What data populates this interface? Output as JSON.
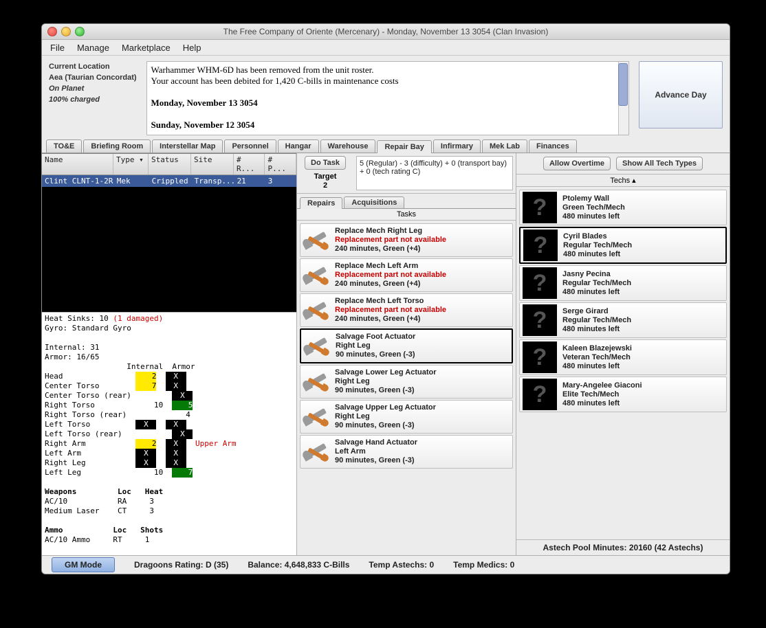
{
  "window_title": "The Free Company of Oriente (Mercenary) - Monday, November 13 3054 (Clan Invasion)",
  "menu": [
    "File",
    "Manage",
    "Marketplace",
    "Help"
  ],
  "location": {
    "header": "Current Location",
    "place": "Aea (Taurian Concordat)",
    "status": "On Planet",
    "charge": "100% charged"
  },
  "log": {
    "line1": "Warhammer WHM-6D has been removed from the unit roster.",
    "line2": "Your account has been debited for 1,420 C-bills in maintenance costs",
    "date1": "Monday, November 13 3054",
    "date2": "Sunday, November 12 3054"
  },
  "advance_label": "Advance Day",
  "tabs": [
    "TO&E",
    "Briefing Room",
    "Interstellar Map",
    "Personnel",
    "Hangar",
    "Warehouse",
    "Repair Bay",
    "Infirmary",
    "Mek Lab",
    "Finances"
  ],
  "active_tab_index": 6,
  "unit_table": {
    "headers": [
      "Name",
      "Type ▾",
      "Status",
      "Site",
      "# R...",
      "# P..."
    ],
    "row": {
      "name": "Clint CLNT-1-2R",
      "type": "Mek",
      "status": "Crippled",
      "site": "Transp...",
      "r": "21",
      "p": "3"
    }
  },
  "detail_text": {
    "l1": "Heat Sinks: 10 ",
    "l1d": "(1 damaged)",
    "l2": "Gyro: Standard Gyro",
    "l3": "",
    "l4": "Internal: 31",
    "l5": "Armor: 16/65",
    "hdr": "                  Internal  Armor",
    "arm_note": "Upper Arm",
    "weap_h": "Weapons         Loc   Heat",
    "w1": "AC/10           RA     3",
    "w2": "Medium Laser    CT     3",
    "ammo_h": "Ammo           Loc   Shots",
    "a1": "AC/10 Ammo     RT     1"
  },
  "locations": [
    {
      "name": "Head",
      "int_type": "y",
      "int_v": "2",
      "arm_type": "k",
      "arm_v": "X"
    },
    {
      "name": "Center Torso",
      "int_type": "y",
      "int_v": "7",
      "arm_type": "k",
      "arm_v": "X"
    },
    {
      "name": "Center Torso (rear)",
      "int_type": "",
      "int_v": "",
      "arm_type": "k",
      "arm_v": "X"
    },
    {
      "name": "Right Torso",
      "int_type": "p",
      "int_v": "10",
      "arm_type": "g",
      "arm_v": "5"
    },
    {
      "name": "Right Torso (rear)",
      "int_type": "",
      "int_v": "",
      "arm_type": "p",
      "arm_v": "4"
    },
    {
      "name": "Left Torso",
      "int_type": "k",
      "int_v": "X",
      "arm_type": "k",
      "arm_v": "X"
    },
    {
      "name": "Left Torso (rear)",
      "int_type": "",
      "int_v": "",
      "arm_type": "k",
      "arm_v": "X"
    },
    {
      "name": "Right Arm",
      "int_type": "y",
      "int_v": "2",
      "arm_type": "k",
      "arm_v": "X"
    },
    {
      "name": "Left Arm",
      "int_type": "k",
      "int_v": "X",
      "arm_type": "k",
      "arm_v": "X"
    },
    {
      "name": "Right Leg",
      "int_type": "k",
      "int_v": "X",
      "arm_type": "k",
      "arm_v": "X"
    },
    {
      "name": "Left Leg",
      "int_type": "p",
      "int_v": "10",
      "arm_type": "g",
      "arm_v": "7"
    }
  ],
  "do_task": {
    "button": "Do Task",
    "target_lbl": "Target",
    "target_v": "2",
    "formula": "5 (Regular) - 3 (difficulty) + 0 (transport bay) + 0 (tech rating C)"
  },
  "subtabs": [
    "Repairs",
    "Acquisitions"
  ],
  "subtab_active": 0,
  "tasks_header": "Tasks",
  "tasks": [
    {
      "title": "Replace Mech Right Leg",
      "err": "Replacement part not available",
      "line3": "240 minutes, Green (+4)",
      "sel": false
    },
    {
      "title": "Replace Mech Left Arm",
      "err": "Replacement part not available",
      "line3": "240 minutes, Green (+4)",
      "sel": false
    },
    {
      "title": "Replace Mech Left Torso",
      "err": "Replacement part not available",
      "line3": "240 minutes, Green (+4)",
      "sel": false
    },
    {
      "title": "Salvage Foot Actuator",
      "sub": "Right Leg",
      "line3": "90 minutes, Green (-3)",
      "sel": true
    },
    {
      "title": "Salvage Lower Leg Actuator",
      "sub": "Right Leg",
      "line3": "90 minutes, Green (-3)",
      "sel": false
    },
    {
      "title": "Salvage Upper Leg Actuator",
      "sub": "Right Leg",
      "line3": "90 minutes, Green (-3)",
      "sel": false
    },
    {
      "title": "Salvage Hand Actuator",
      "sub": "Left Arm",
      "line3": "90 minutes, Green (-3)",
      "sel": false
    }
  ],
  "r_buttons": {
    "ot": "Allow Overtime",
    "all": "Show All Tech Types"
  },
  "techs_header": "Techs ▴",
  "techs": [
    {
      "name": "Ptolemy Wall",
      "role": "Green Tech/Mech",
      "time": "480 minutes left",
      "sel": false
    },
    {
      "name": "Cyril Blades",
      "role": "Regular Tech/Mech",
      "time": "480 minutes left",
      "sel": true
    },
    {
      "name": "Jasny Pecina",
      "role": "Regular Tech/Mech",
      "time": "480 minutes left",
      "sel": false
    },
    {
      "name": "Serge Girard",
      "role": "Regular Tech/Mech",
      "time": "480 minutes left",
      "sel": false
    },
    {
      "name": "Kaleen Blazejewski",
      "role": "Veteran Tech/Mech",
      "time": "480 minutes left",
      "sel": false
    },
    {
      "name": "Mary-Angelee Giaconi",
      "role": "Elite Tech/Mech",
      "time": "480 minutes left",
      "sel": false
    }
  ],
  "astech": "Astech Pool Minutes: 20160 (42 Astechs)",
  "statusbar": {
    "gm": "GM Mode",
    "rating": "Dragoons Rating: D (35)",
    "balance": "Balance: 4,648,833 C-Bills",
    "tempa": "Temp Astechs: 0",
    "tempm": "Temp Medics: 0"
  }
}
